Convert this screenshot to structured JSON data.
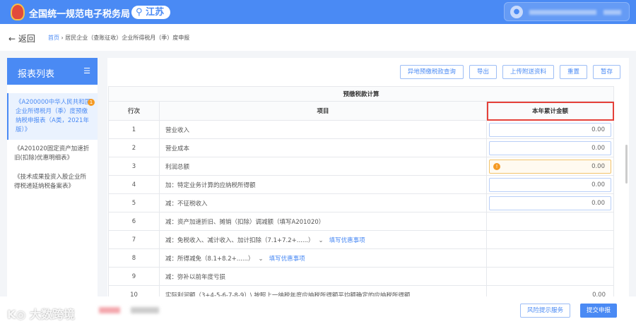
{
  "header": {
    "title": "全国统一规范电子税务局",
    "region": "江苏"
  },
  "nav": {
    "back": "返回",
    "breadcrumb": [
      "首页",
      "居民企业（查账征收）企业所得税月（季）度申报"
    ],
    "sep": "›"
  },
  "sidebar": {
    "title": "报表列表",
    "items": [
      {
        "label": "《A200000中华人民共和国企业所得税月（季）度预缴纳税申报表（A类，2021年版）》",
        "badge": "1"
      },
      {
        "label": "《A201020固定资产加速折旧(扣除)优惠明细表》"
      },
      {
        "label": "《技术成果投资入股企业所得税递延纳税备案表》"
      }
    ]
  },
  "toolbar": {
    "buttons": [
      "异地预缴税款查询",
      "导出",
      "上传附送资料",
      "重置",
      "暂存"
    ]
  },
  "table": {
    "caption": "预缴税款计算",
    "headers": [
      "行次",
      "项目",
      "本年累计金额"
    ],
    "rows": [
      {
        "no": "1",
        "item": "营业收入",
        "amount": "0.00"
      },
      {
        "no": "2",
        "item": "营业成本",
        "amount": "0.00"
      },
      {
        "no": "3",
        "item": "利润总额",
        "amount": "0.00",
        "warning": true
      },
      {
        "no": "4",
        "item": "加：特定业务计算的应纳税所得额",
        "amount": "0.00"
      },
      {
        "no": "5",
        "item": "减：不征税收入",
        "amount": "0.00"
      },
      {
        "no": "6",
        "item": "减：资产加速折旧、摊销（扣除）调减额（填写A201020）"
      },
      {
        "no": "7",
        "item": "减：免税收入、减计收入、加计扣除（7.1+7.2+......）",
        "link": "填写优惠事项"
      },
      {
        "no": "8",
        "item": "减：所得减免（8.1+8.2+......）",
        "link": "填写优惠事项"
      },
      {
        "no": "9",
        "item": "减：弥补以前年度亏损"
      },
      {
        "no": "10",
        "item": "实际利润额（3+4-5-6-7-8-9）\\ 按照上一纳税年度应纳税所得额平均额确定的应纳税所得额",
        "amount": "0.00"
      }
    ]
  },
  "footer": {
    "watermark": "大数跨境",
    "risk": "风险提示服务",
    "submit": "提交申报"
  }
}
